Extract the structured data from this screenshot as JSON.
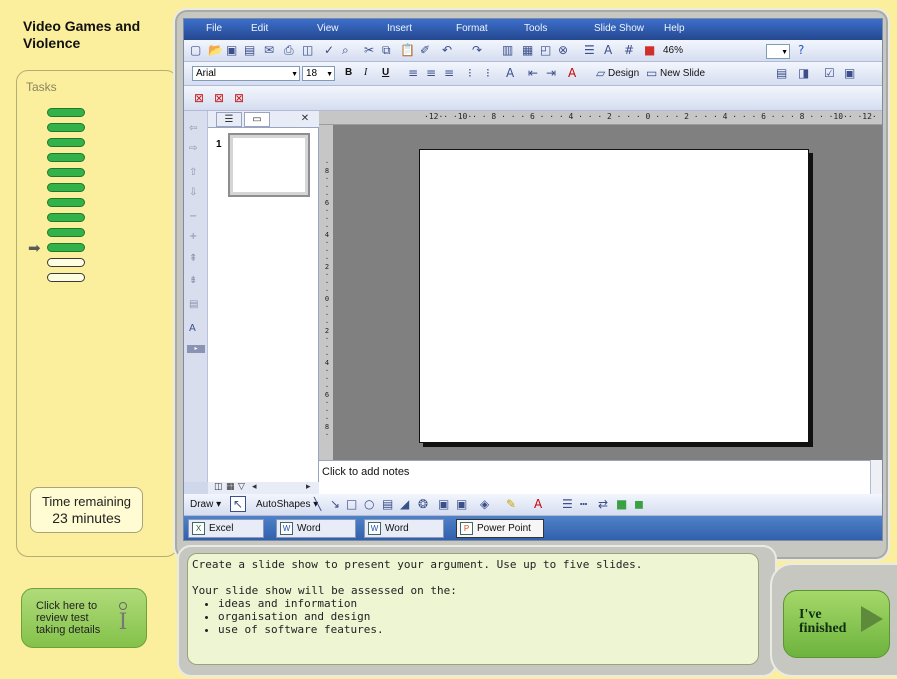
{
  "sidebar": {
    "title": "Video Games and Violence",
    "tasks_label": "Tasks",
    "task_pills": {
      "completed": 10,
      "remaining": 2,
      "current_index": 10
    },
    "time_label": "Time remaining",
    "time_value": "23",
    "time_unit": "minutes",
    "review_button": "Click here to review test taking details"
  },
  "app": {
    "menu": [
      "File",
      "Edit",
      "View",
      "Insert",
      "Format",
      "Tools",
      "Slide Show",
      "Help"
    ],
    "toolbar": {
      "zoom": "46%",
      "font": "Arial",
      "font_size": "18",
      "bold": "B",
      "italic": "I",
      "underline": "U",
      "design_label": "Design",
      "new_slide_label": "New Slide"
    },
    "outline_pane": {
      "slide_number": "1"
    },
    "ruler_h": "·12·· ·10·· · 8 · · · 6 · · · 4 · · · 2 · · · 0 · · · 2 · · · 4 · · · 6 · · · 8 · · ·10·· ·12·",
    "ruler_v": "·\n8\n·\n·\n·\n6\n·\n·\n·\n4\n·\n·\n·\n2\n·\n·\n·\n0\n·\n·\n·\n2\n·\n·\n·\n4\n·\n·\n·\n6\n·\n·\n·\n8\n·",
    "notes_placeholder": "Click to add notes",
    "drawbar": {
      "draw_label": "Draw ▾",
      "autoshapes_label": "AutoShapes ▾"
    },
    "taskbar": [
      {
        "label": "Excel",
        "icon": "excel-icon",
        "active": false
      },
      {
        "label": "Word",
        "icon": "word-icon",
        "active": false
      },
      {
        "label": "Word",
        "icon": "word-icon",
        "active": false
      },
      {
        "label": "Power Point",
        "icon": "powerpoint-icon",
        "active": true
      }
    ]
  },
  "instructions": {
    "line1": "Create a slide show to present your argument. Use up to five slides.",
    "line2": "Your slide show will be assessed on the:",
    "bullets": [
      "ideas and information",
      "organisation and design",
      "use of software features."
    ]
  },
  "finish_button": {
    "line1": "I've",
    "line2": "finished"
  },
  "colors": {
    "background": "#fbee9c",
    "pill_done": "#33b24a",
    "title_bar": "#24488f",
    "button_green": "#84c24a"
  }
}
